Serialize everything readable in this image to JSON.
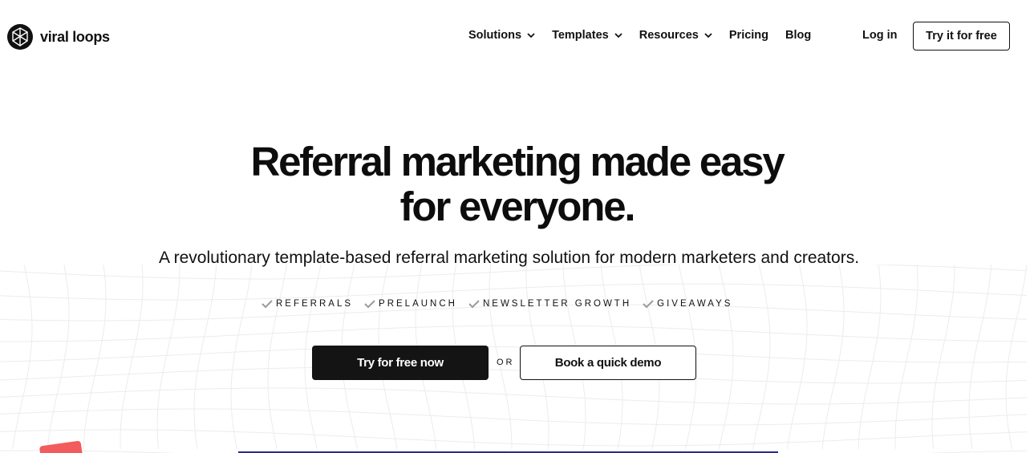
{
  "brand": {
    "name": "viral loops"
  },
  "nav": {
    "items": [
      {
        "label": "Solutions",
        "dropdown": true
      },
      {
        "label": "Templates",
        "dropdown": true
      },
      {
        "label": "Resources",
        "dropdown": true
      },
      {
        "label": "Pricing",
        "dropdown": false
      },
      {
        "label": "Blog",
        "dropdown": false
      }
    ],
    "login_label": "Log in",
    "try_label": "Try it for free"
  },
  "hero": {
    "title_line1": "Referral marketing made easy",
    "title_line2": "for everyone.",
    "subtitle": "A revolutionary template-based referral marketing solution for modern marketers and creators.",
    "features": [
      "REFERRALS",
      "PRELAUNCH",
      "NEWSLETTER GROWTH",
      "GIVEAWAYS"
    ],
    "cta_primary": "Try for free now",
    "or_label": "OR",
    "cta_secondary": "Book a quick demo"
  },
  "icons": {
    "logo": "viral-loops-logo-icon",
    "chevron": "chevron-down-icon",
    "check": "check-icon"
  },
  "colors": {
    "primary_button": "#141414",
    "accent_red": "#f25c5c",
    "accent_navy": "#2d2a8c",
    "check_gray": "#9a9a9a"
  }
}
